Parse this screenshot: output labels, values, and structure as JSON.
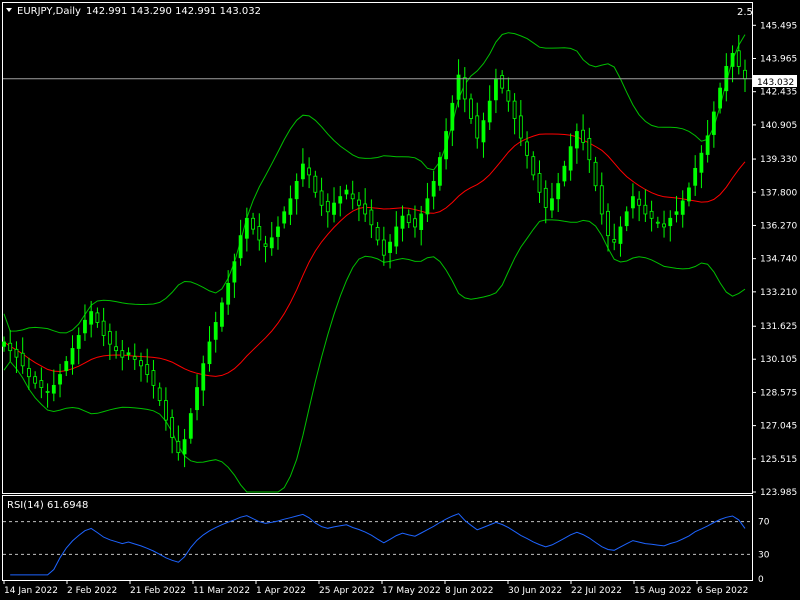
{
  "header": {
    "symbol_info": "EURJPY,Daily",
    "ohlc": "142.991 143.290 142.991 143.032",
    "zoom_label": "2.5"
  },
  "price_line": {
    "value": 143.032,
    "label": "143.032"
  },
  "rsi": {
    "label": "RSI(14) 61.6948",
    "levels": [
      70,
      30
    ]
  },
  "colors": {
    "background": "#000000",
    "frame": "#ffffff",
    "candle": "#00ff00",
    "moving_average": "#ff0000",
    "bollinger": "#00c000",
    "rsi_line": "#1e64ff",
    "level_line": "#c0c0c0"
  },
  "chart_data": [
    {
      "type": "candlestick",
      "title": "EURJPY,Daily",
      "indicators": [
        "Bollinger Bands",
        "Moving Average"
      ],
      "y_ticks": [
        "145.495",
        "143.965",
        "142.435",
        "140.905",
        "139.330",
        "137.800",
        "136.270",
        "134.740",
        "133.210",
        "131.625",
        "130.105",
        "128.575",
        "127.045",
        "125.515",
        "123.985"
      ],
      "ylim": [
        123.985,
        146.2
      ],
      "x_ticks": [
        "14 Jan 2022",
        "2 Feb 2022",
        "21 Feb 2022",
        "11 Mar 2022",
        "1 Apr 2022",
        "25 Apr 2022",
        "17 May 2022",
        "8 Jun 2022",
        "30 Jun 2022",
        "22 Jul 2022",
        "15 Aug 2022",
        "6 Sep 2022"
      ],
      "close": [
        130.9,
        130.5,
        130.2,
        129.8,
        129.3,
        129.0,
        128.8,
        128.6,
        128.9,
        129.4,
        130.0,
        130.6,
        131.2,
        131.9,
        132.3,
        131.8,
        131.2,
        130.8,
        130.5,
        130.2,
        130.4,
        130.1,
        129.8,
        129.4,
        128.9,
        128.2,
        127.3,
        126.5,
        125.8,
        126.4,
        127.6,
        128.8,
        129.9,
        130.9,
        131.8,
        132.7,
        133.6,
        134.6,
        135.8,
        136.6,
        136.1,
        135.6,
        135.3,
        135.7,
        136.2,
        136.9,
        137.5,
        138.3,
        139.1,
        138.6,
        137.8,
        137.2,
        136.9,
        137.3,
        137.6,
        137.9,
        137.5,
        137.2,
        136.8,
        136.3,
        135.6,
        134.9,
        135.5,
        136.2,
        136.7,
        136.4,
        136.2,
        136.8,
        137.5,
        138.3,
        139.4,
        140.6,
        141.9,
        143.2,
        142.1,
        141.2,
        140.3,
        141.1,
        142.0,
        143.0,
        142.6,
        142.0,
        141.2,
        140.3,
        139.5,
        138.6,
        137.8,
        137.1,
        137.5,
        138.2,
        139.0,
        139.9,
        140.6,
        140.1,
        139.3,
        138.1,
        136.8,
        135.8,
        135.5,
        136.2,
        136.9,
        137.6,
        137.2,
        136.8,
        136.6,
        136.4,
        136.2,
        136.6,
        136.9,
        137.4,
        138.0,
        138.9,
        139.6,
        140.4,
        141.5,
        142.6,
        143.6,
        144.2,
        143.6,
        143.032
      ]
    },
    {
      "type": "line",
      "title": "RSI(14) 61.6948",
      "y_ticks": [
        "70",
        "30",
        "0"
      ],
      "ylim": [
        0,
        100
      ],
      "last_value": 61.6948
    }
  ]
}
